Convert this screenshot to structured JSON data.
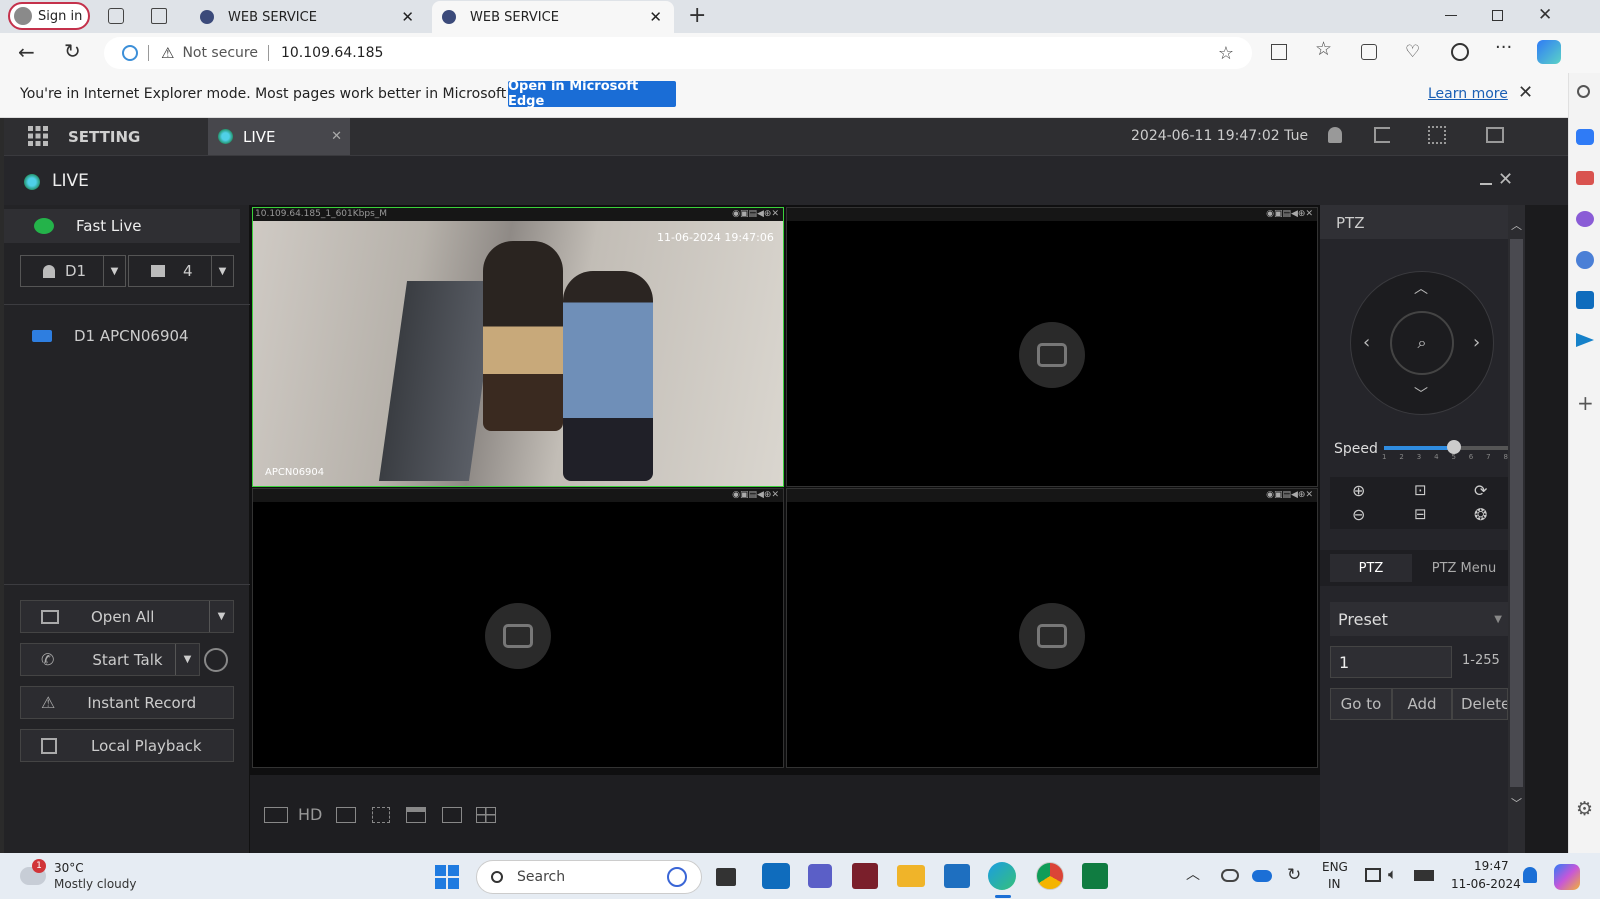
{
  "browser": {
    "profile_label": "Sign in",
    "tabs": [
      {
        "title": "WEB SERVICE"
      },
      {
        "title": "WEB SERVICE"
      }
    ],
    "security_label": "Not secure",
    "url": "10.109.64.185",
    "ie_notice": "You're in Internet Explorer mode. Most pages work better in Microsoft Edge.",
    "open_edge_label": "Open in Microsoft Edge",
    "learn_more_label": "Learn more"
  },
  "app": {
    "setting_label": "SETTING",
    "live_tab_label": "LIVE",
    "datetime": "2024-06-11 19:47:02 Tue",
    "live_title": "LIVE"
  },
  "left_panel": {
    "fast_live": "Fast Live",
    "device_select": "D1",
    "layout_select": "4",
    "channel": "D1 APCN06904",
    "buttons": {
      "open_all": "Open All",
      "start_talk": "Start Talk",
      "instant_record": "Instant Record",
      "local_playback": "Local Playback"
    }
  },
  "video": {
    "cell1_info": "10.109.64.185_1_601Kbps_M",
    "cell1_timestamp": "11-06-2024 19:47:06",
    "cell1_cam_name": "APCN06904",
    "bottom_hd": "HD"
  },
  "ptz": {
    "title": "PTZ",
    "speed_label": "Speed",
    "speed_ticks": [
      "1",
      "2",
      "3",
      "4",
      "5",
      "6",
      "7",
      "8"
    ],
    "speed_value": 5,
    "tab_ptz": "PTZ",
    "tab_menu": "PTZ Menu",
    "preset_label": "Preset",
    "preset_value": "1",
    "preset_range": "1-255",
    "goto_label": "Go to",
    "add_label": "Add",
    "delete_label": "Delete"
  },
  "taskbar": {
    "weather_temp": "30°C",
    "weather_desc": "Mostly cloudy",
    "weather_badge": "1",
    "search_label": "Search",
    "lang1": "ENG",
    "lang2": "IN",
    "time": "19:47",
    "date": "11-06-2024"
  }
}
